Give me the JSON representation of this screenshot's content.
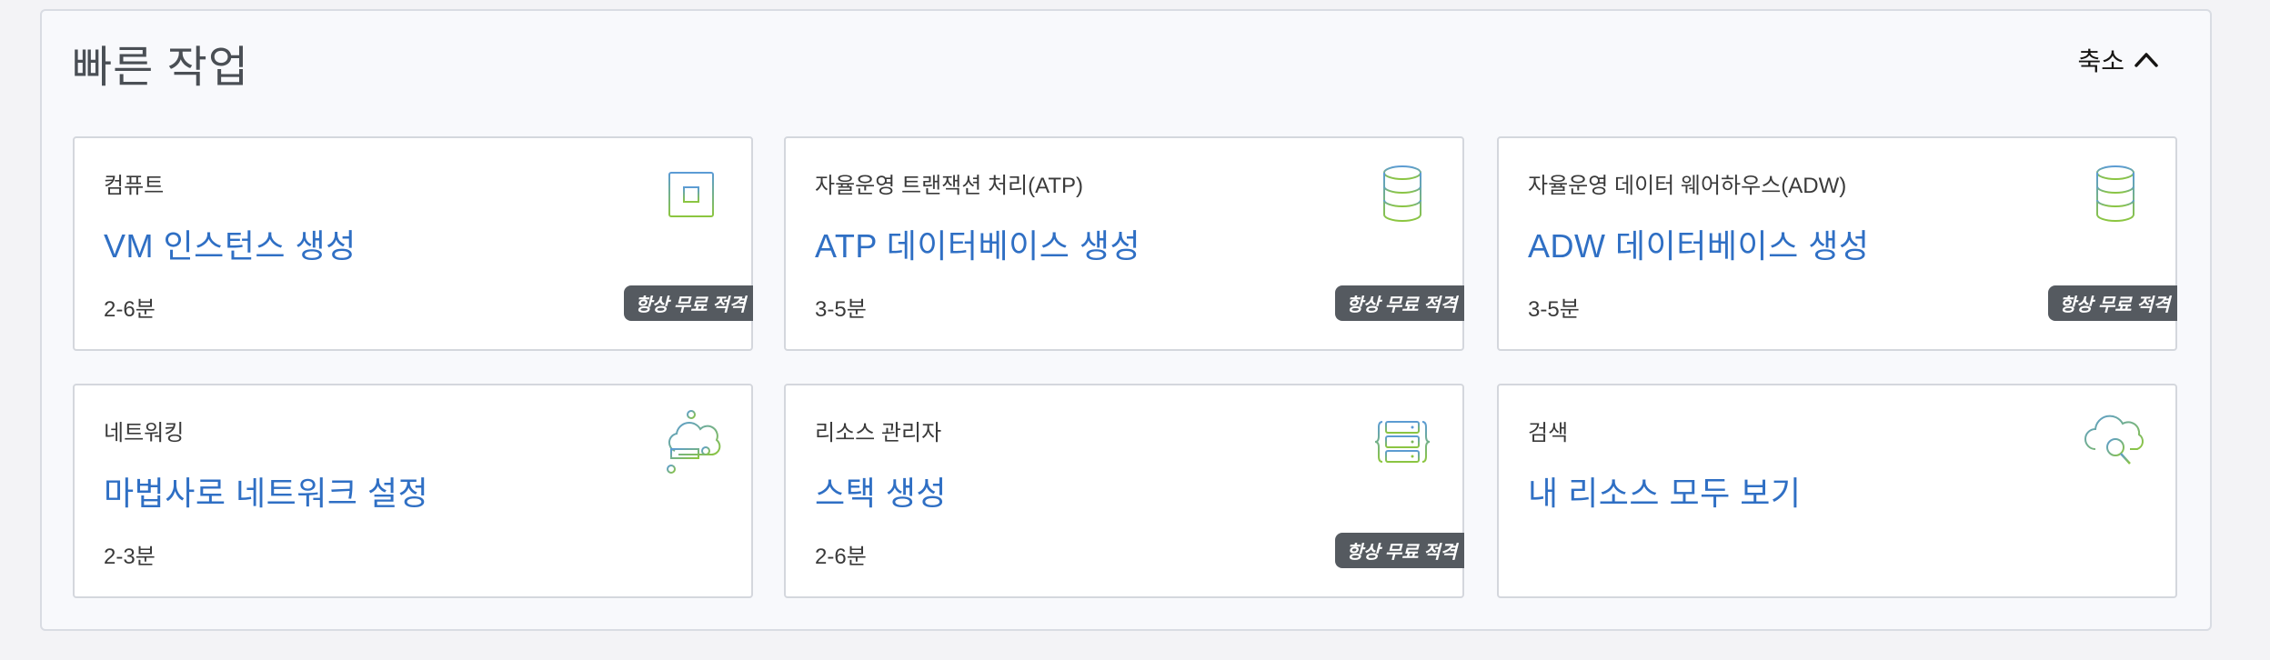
{
  "panel": {
    "title": "빠른 작업",
    "collapse_label": "축소"
  },
  "cards": [
    {
      "category": "컴퓨트",
      "action": "VM 인스턴스 생성",
      "duration": "2-6분",
      "badge": "항상 무료 적격",
      "icon": "cpu-chip-icon"
    },
    {
      "category": "자율운영 트랜잭션 처리(ATP)",
      "action": "ATP 데이터베이스 생성",
      "duration": "3-5분",
      "badge": "항상 무료 적격",
      "icon": "database-icon"
    },
    {
      "category": "자율운영 데이터 웨어하우스(ADW)",
      "action": "ADW 데이터베이스 생성",
      "duration": "3-5분",
      "badge": "항상 무료 적격",
      "icon": "database-icon"
    },
    {
      "category": "네트워킹",
      "action": "마법사로 네트워크 설정",
      "duration": "2-3분",
      "icon": "cloud-network-icon"
    },
    {
      "category": "리소스 관리자",
      "action": "스택 생성",
      "duration": "2-6분",
      "badge": "항상 무료 적격",
      "icon": "stack-icon"
    },
    {
      "category": "검색",
      "action": "내 리소스 모두 보기",
      "icon": "cloud-search-icon"
    }
  ],
  "colors": {
    "link": "#2f6fc4",
    "badge_bg": "#555a60",
    "icon_green": "#8cc63f",
    "icon_blue": "#5b9bd5"
  }
}
